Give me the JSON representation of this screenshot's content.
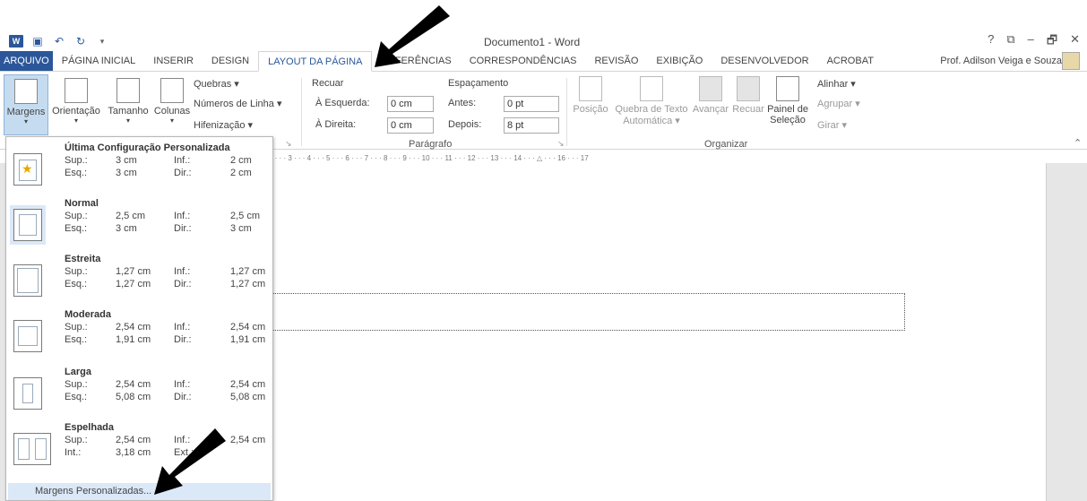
{
  "window": {
    "title": "Documento1 - Word",
    "controls": [
      "?",
      "⧉",
      "–",
      "🗗",
      "✕"
    ]
  },
  "tabs": [
    "ARQUIVO",
    "PÁGINA INICIAL",
    "INSERIR",
    "DESIGN",
    "LAYOUT DA PÁGINA",
    "REFERÊNCIAS",
    "CORRESPONDÊNCIAS",
    "REVISÃO",
    "EXIBIÇÃO",
    "DESENVOLVEDOR",
    "ACROBAT"
  ],
  "user": "Prof. Adilson Veiga e Souza",
  "ribbon": {
    "margens": "Margens",
    "orientacao": "Orientação",
    "tamanho": "Tamanho",
    "colunas": "Colunas",
    "quebras": "Quebras ▾",
    "numeros": "Números de Linha ▾",
    "hifenizacao": "Hifenização ▾",
    "recuar": "Recuar",
    "esquerda_label": "À Esquerda:",
    "esquerda_val": "0 cm",
    "direita_label": "À Direita:",
    "direita_val": "0 cm",
    "espacamento": "Espaçamento",
    "antes_label": "Antes:",
    "antes_val": "0 pt",
    "depois_label": "Depois:",
    "depois_val": "8 pt",
    "paragrafo": "Parágrafo",
    "posicao": "Posição",
    "quebra_texto": "Quebra de Texto",
    "automatica": "Automática ▾",
    "avancar": "Avançar",
    "recuar2": "Recuar",
    "painel": "Painel de",
    "selecao": "Seleção",
    "alinhar": "Alinhar ▾",
    "agrupar": "Agrupar ▾",
    "girar": "Girar ▾",
    "organizar": "Organizar"
  },
  "ruler": "2 · · · 3 · · · 4 · · · 5 · · · 6 · · · 7 · · · 8 · · · 9 · · · 10 · · · 11 · · · 12 · · · 13 · · · 14 · · · △ · · · 16 · · · 17",
  "margins_menu": {
    "options": [
      {
        "name": "Última Configuração Personalizada",
        "sup": "3 cm",
        "inf": "2 cm",
        "esq_label": "Esq.:",
        "esq": "3 cm",
        "dir": "2 cm"
      },
      {
        "name": "Normal",
        "sup": "2,5 cm",
        "inf": "2,5 cm",
        "esq_label": "Esq.:",
        "esq": "3 cm",
        "dir": "3 cm"
      },
      {
        "name": "Estreita",
        "sup": "1,27 cm",
        "inf": "1,27 cm",
        "esq_label": "Esq.:",
        "esq": "1,27 cm",
        "dir": "1,27 cm"
      },
      {
        "name": "Moderada",
        "sup": "2,54 cm",
        "inf": "2,54 cm",
        "esq_label": "Esq.:",
        "esq": "1,91 cm",
        "dir": "1,91 cm"
      },
      {
        "name": "Larga",
        "sup": "2,54 cm",
        "inf": "2,54 cm",
        "esq_label": "Esq.:",
        "esq": "5,08 cm",
        "dir": "5,08 cm"
      },
      {
        "name": "Espelhada",
        "sup": "2,54 cm",
        "inf": "2,54 cm",
        "esq_label": "Int.:",
        "esq": "3,18 cm",
        "dir": ""
      }
    ],
    "labels": {
      "sup": "Sup.:",
      "inf": "Inf.:",
      "dir": "Dir.:",
      "ext": "Ext.:"
    },
    "custom": "Margens Personalizadas..."
  }
}
